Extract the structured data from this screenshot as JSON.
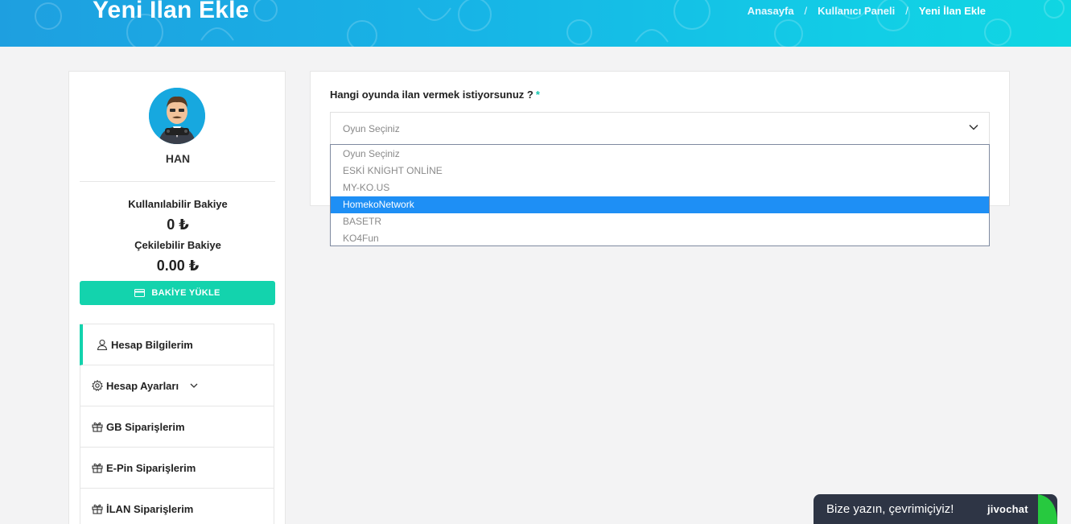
{
  "header": {
    "title": "Yeni İlan Ekle",
    "breadcrumb": [
      "Anasayfa",
      "Kullanıcı Paneli",
      "Yeni İlan Ekle"
    ],
    "separator": "/"
  },
  "profile": {
    "username": "HAN",
    "available_balance_label": "Kullanılabilir Bakiye",
    "available_balance_value": "0 ₺",
    "withdrawable_balance_label": "Çekilebilir Bakiye",
    "withdrawable_balance_value": "0.00 ₺",
    "topup_button_label": "BAKİYE YÜKLE"
  },
  "menu": {
    "items": [
      {
        "label": "Hesap Bilgilerim",
        "icon": "user-icon"
      },
      {
        "label": "Hesap Ayarları",
        "icon": "gear-icon"
      },
      {
        "label": "GB Siparişlerim",
        "icon": "gift-icon"
      },
      {
        "label": "E-Pin Siparişlerim",
        "icon": "gift-icon"
      },
      {
        "label": "İLAN Siparişlerim",
        "icon": "gift-icon"
      }
    ]
  },
  "form": {
    "game_question": "Hangi oyunda ilan vermek istiyorsunuz ?",
    "required_mark": "*",
    "selected_value": "Oyun Seçiniz",
    "options": [
      "Oyun Seçiniz",
      "ESKİ KNİGHT ONLİNE",
      "MY-KO.US",
      "HomekoNetwork",
      "BASETR",
      "KO4Fun"
    ],
    "highlighted_option": "HomekoNetwork"
  },
  "chat": {
    "message": "Bize yazın, çevrimiçiyiz!",
    "brand": "jivochat"
  },
  "colors": {
    "accent": "#13d3ad",
    "banner_start": "#1e9fe0",
    "banner_end": "#10d6e2",
    "highlight": "#1e8ff5",
    "chat_bg": "#2e3545"
  }
}
